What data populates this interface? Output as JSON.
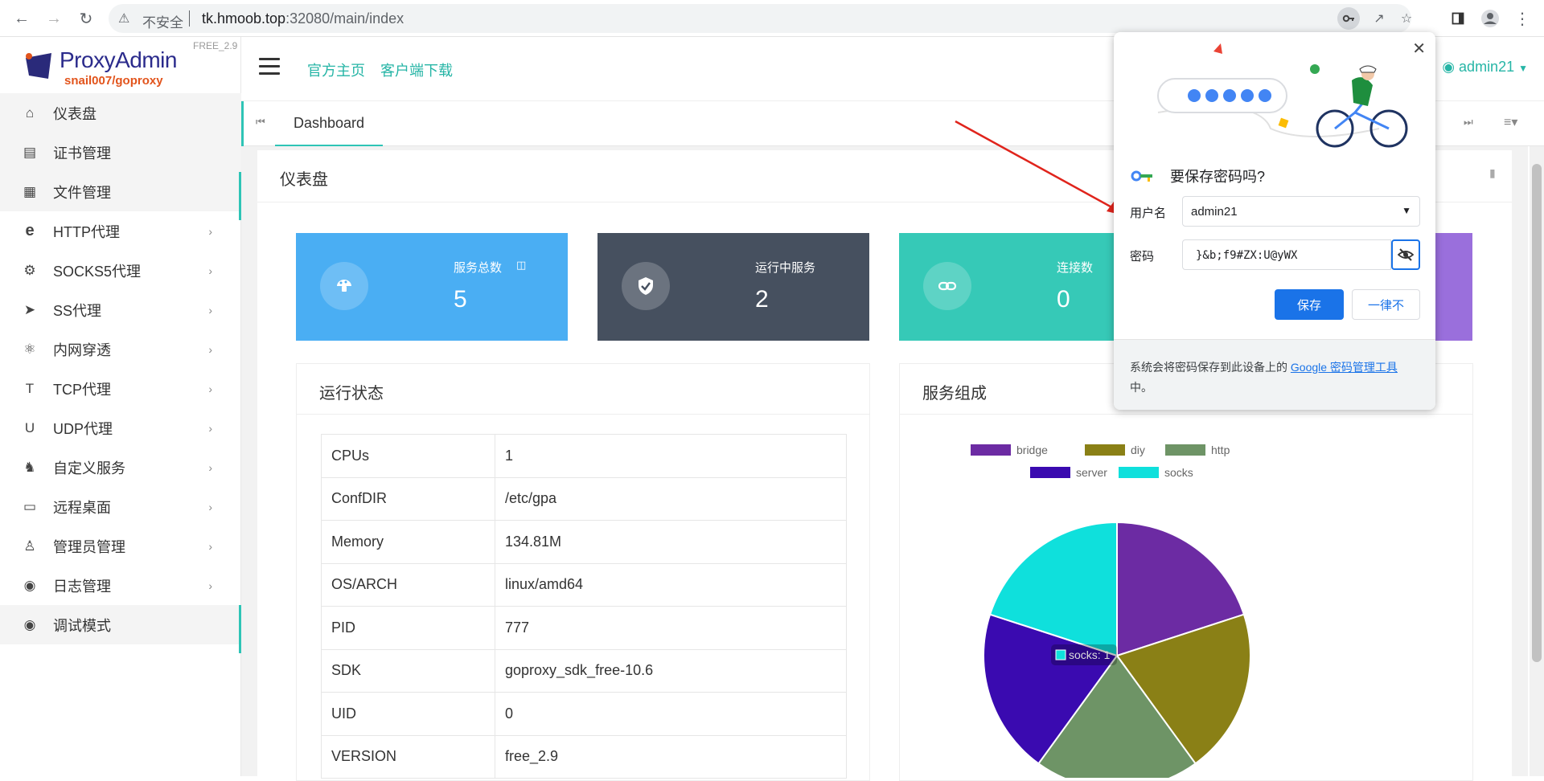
{
  "browser": {
    "security_label": "不安全",
    "url_host": "tk.hmoob.top",
    "url_path": ":32080/main/index"
  },
  "sidebar": {
    "logo_title": "ProxyAdmin",
    "logo_sub": "snail007/goproxy",
    "version": "FREE_2.9",
    "items": [
      {
        "label": "仪表盘",
        "icon": "home-icon",
        "has_submenu": false
      },
      {
        "label": "证书管理",
        "icon": "card-icon",
        "has_submenu": false
      },
      {
        "label": "文件管理",
        "icon": "file-icon",
        "has_submenu": false
      },
      {
        "label": "HTTP代理",
        "icon": "edge-e-icon",
        "has_submenu": true
      },
      {
        "label": "SOCKS5代理",
        "icon": "globe-icon",
        "has_submenu": true
      },
      {
        "label": "SS代理",
        "icon": "send-icon",
        "has_submenu": true
      },
      {
        "label": "内网穿透",
        "icon": "atom-icon",
        "has_submenu": true
      },
      {
        "label": "TCP代理",
        "icon": "text-t-icon",
        "has_submenu": true
      },
      {
        "label": "UDP代理",
        "icon": "underline-icon",
        "has_submenu": true
      },
      {
        "label": "自定义服务",
        "icon": "puzzle-icon",
        "has_submenu": true
      },
      {
        "label": "远程桌面",
        "icon": "monitor-icon",
        "has_submenu": true
      },
      {
        "label": "管理员管理",
        "icon": "person-icon",
        "has_submenu": true
      },
      {
        "label": "日志管理",
        "icon": "camera-icon",
        "has_submenu": true
      },
      {
        "label": "调试模式",
        "icon": "bug-icon",
        "has_submenu": false
      }
    ]
  },
  "header": {
    "links": [
      "官方主页",
      "客户端下载"
    ],
    "user": "admin21"
  },
  "tabs": {
    "active": "Dashboard"
  },
  "dashboard": {
    "title": "仪表盘",
    "cards": [
      {
        "label": "服务总数",
        "value": "5",
        "color": "#4aaef3",
        "icon": "mushroom-icon"
      },
      {
        "label": "运行中服务",
        "value": "2",
        "color": "#46505f",
        "icon": "shield-check-icon"
      },
      {
        "label": "连接数",
        "value": "0",
        "color": "#36c9b7",
        "icon": "link-icon"
      },
      {
        "label": "",
        "value": "",
        "color": "#9a6fdc",
        "icon": ""
      }
    ],
    "status_title": "运行状态",
    "status_rows": [
      {
        "key": "CPUs",
        "value": "1"
      },
      {
        "key": "ConfDIR",
        "value": "/etc/gpa"
      },
      {
        "key": "Memory",
        "value": "134.81M"
      },
      {
        "key": "OS/ARCH",
        "value": "linux/amd64"
      },
      {
        "key": "PID",
        "value": "777"
      },
      {
        "key": "SDK",
        "value": "goproxy_sdk_free-10.6"
      },
      {
        "key": "UID",
        "value": "0"
      },
      {
        "key": "VERSION",
        "value": "free_2.9"
      }
    ],
    "composition_title": "服务组成"
  },
  "chart_data": {
    "type": "pie",
    "categories": [
      "bridge",
      "diy",
      "http",
      "server",
      "socks"
    ],
    "values": [
      1,
      1,
      1,
      1,
      1
    ],
    "colors": [
      "#6c2ba3",
      "#8a8016",
      "#6e9466",
      "#3a0ab0",
      "#0fe0dc"
    ],
    "tooltip": "socks: 1",
    "legend_position": "top"
  },
  "password_popup": {
    "title": "要保存密码吗?",
    "username_label": "用户名",
    "username_value": "admin21",
    "password_label": "密码",
    "password_value": "}&b;f9#ZX:U@yWX",
    "save_label": "保存",
    "never_label": "一律不",
    "footer_prefix": "系统会将密码保存到此设备上的 ",
    "footer_link": "Google 密码管理工具",
    "footer_suffix": "中。"
  }
}
